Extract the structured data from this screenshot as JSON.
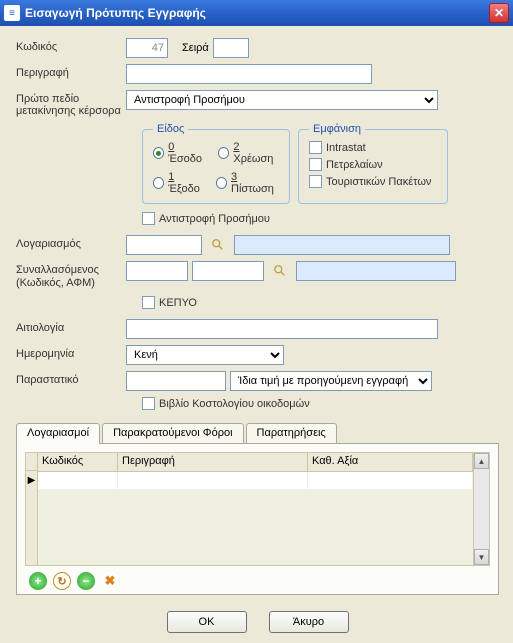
{
  "window": {
    "title": "Εισαγωγή Πρότυπης Εγγραφής"
  },
  "labels": {
    "code": "Κωδικός",
    "series": "Σειρά",
    "description": "Περιγραφή",
    "firstField": "Πρώτο πεδίο μετακίνησης κέρσορα",
    "account": "Λογαριασμός",
    "counterparty": "Συναλλασόμενος (Κωδικός, ΑΦΜ)",
    "justification": "Αιτιολογία",
    "date": "Ημερομηνία",
    "voucher": "Παραστατικό"
  },
  "values": {
    "code": "47"
  },
  "combos": {
    "firstField": "Αντιστροφή Προσήμου",
    "date": "Κενή",
    "voucher": "Ίδια τιμή με προηγούμενη εγγραφή"
  },
  "groups": {
    "type": {
      "legend": "Είδος",
      "options": [
        {
          "key": "0",
          "label": "Έσοδο"
        },
        {
          "key": "2",
          "label": "Χρέωση"
        },
        {
          "key": "1",
          "label": "Έξοδο"
        },
        {
          "key": "3",
          "label": "Πίστωση"
        }
      ]
    },
    "appearance": {
      "legend": "Εμφάνιση",
      "options": [
        "Intrastat",
        "Πετρελαίων",
        "Τουριστικών Πακέτων"
      ]
    }
  },
  "checks": {
    "signReversal": "Αντιστροφή Προσήμου",
    "kepyo": "ΚΕΠΥΟ",
    "buildingCost": "Βιβλίο Κοστολογίου οικοδομών"
  },
  "tabs": [
    "Λογαριασμοί",
    "Παρακρατούμενοι Φόροι",
    "Παρατηρήσεις"
  ],
  "grid": {
    "cols": [
      "Κωδικός",
      "Περιγραφή",
      "Καθ. Αξία"
    ]
  },
  "buttons": {
    "ok": "OK",
    "cancel": "Άκυρο"
  }
}
